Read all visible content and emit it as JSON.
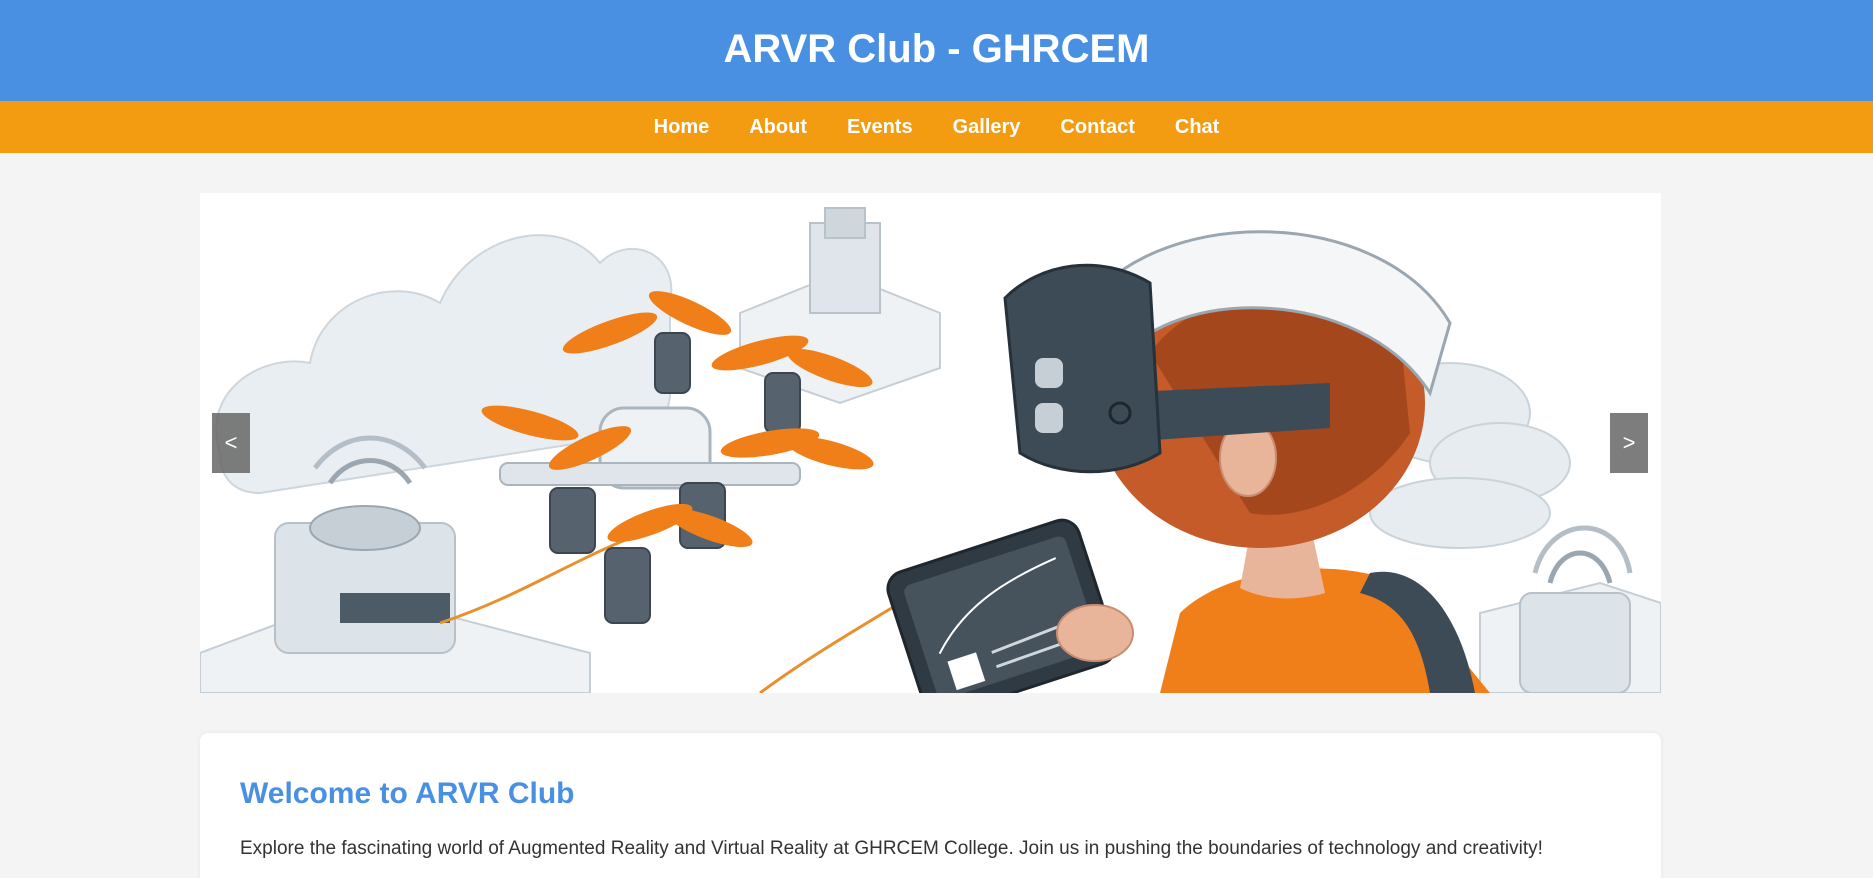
{
  "header": {
    "title": "ARVR Club - GHRCEM"
  },
  "nav": {
    "items": [
      {
        "label": "Home"
      },
      {
        "label": "About"
      },
      {
        "label": "Events"
      },
      {
        "label": "Gallery"
      },
      {
        "label": "Contact"
      },
      {
        "label": "Chat"
      }
    ]
  },
  "slider": {
    "prev_label": "<",
    "next_label": ">"
  },
  "intro": {
    "heading": "Welcome to ARVR Club",
    "text": "Explore the fascinating world of Augmented Reality and Virtual Reality at GHRCEM College. Join us in pushing the boundaries of technology and creativity!"
  },
  "colors": {
    "header_bg": "#4a90e2",
    "nav_bg": "#f39c12",
    "accent_orange": "#f07f1a",
    "headset_dark": "#3d4b57"
  }
}
